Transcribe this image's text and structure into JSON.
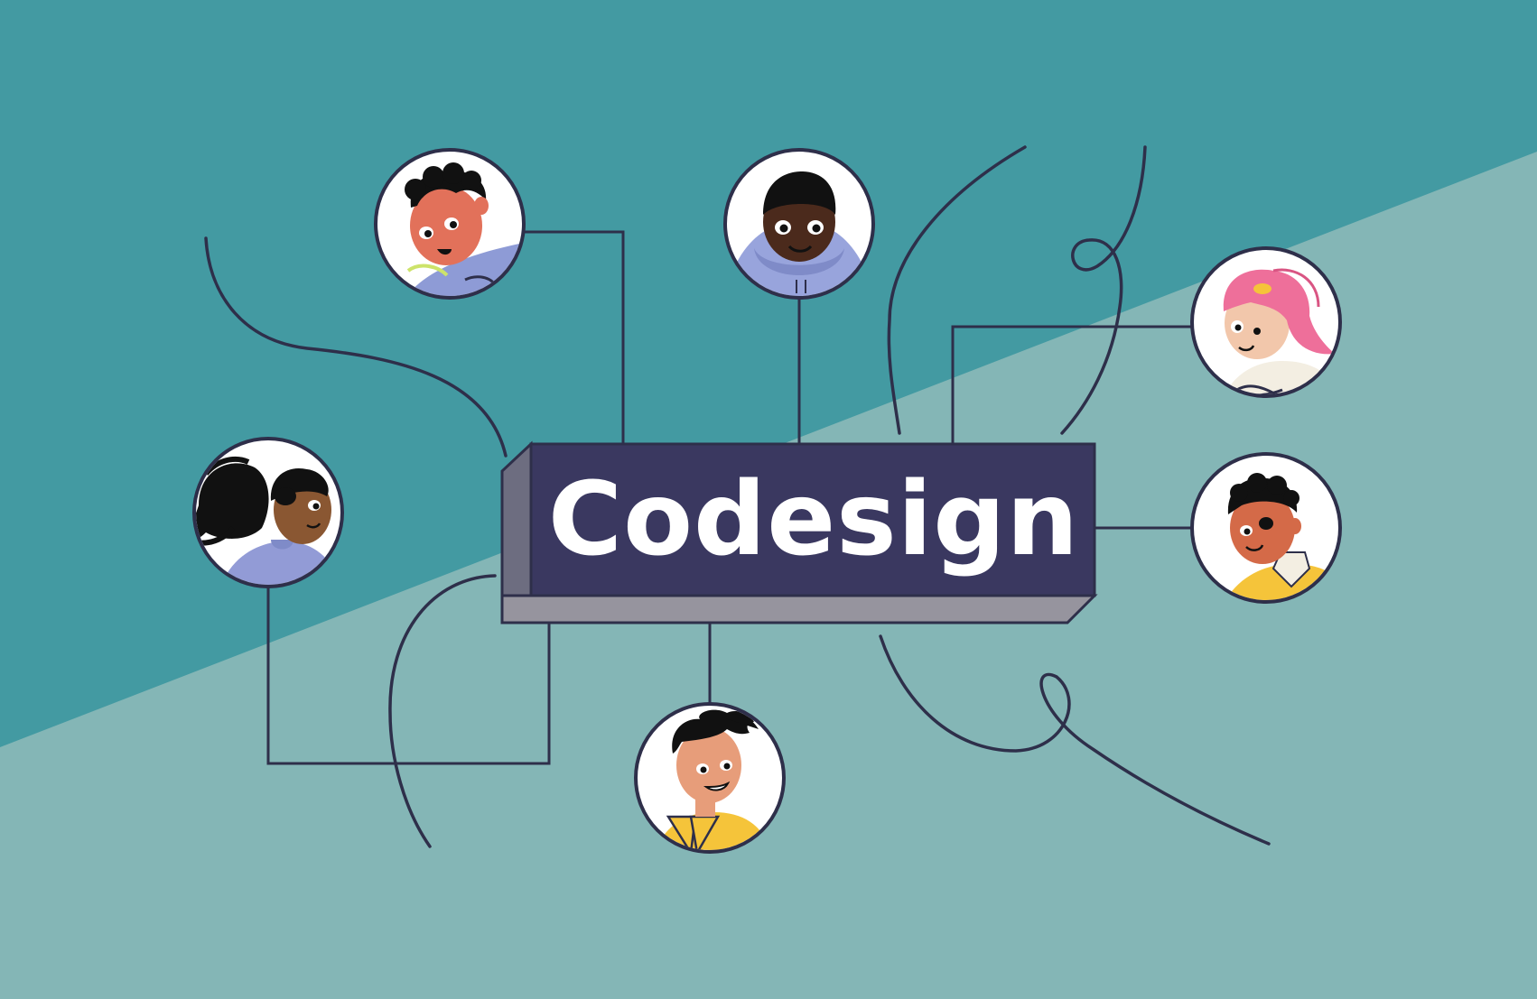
{
  "title": "Codesign",
  "colors": {
    "background_dark": "#439aa2",
    "background_light": "#84b6b6",
    "block_front": "#3a3860",
    "block_top": "#6d6d80",
    "block_bottom": "#96949e",
    "line": "#2e2f4a"
  },
  "avatars": [
    {
      "id": "curly-hair-person-avatar",
      "skin": "#e2715a",
      "hair": "#111111",
      "clothing": "#8e9bd6"
    },
    {
      "id": "hoodie-person-avatar",
      "skin": "#4b2a1c",
      "hair": "#111111",
      "clothing": "#98a4dc"
    },
    {
      "id": "pink-hair-person-avatar",
      "skin": "#f2c7ab",
      "hair": "#ee6f9a",
      "clothing": "#f3eee2"
    },
    {
      "id": "ponytail-person-avatar",
      "skin": "#8a5732",
      "hair": "#111111",
      "clothing": "#929bd6"
    },
    {
      "id": "collared-shirt-person-avatar",
      "skin": "#d46a48",
      "hair": "#111111",
      "clothing": "#f5c43a"
    },
    {
      "id": "spiky-hair-person-avatar",
      "skin": "#e79d7a",
      "hair": "#111111",
      "clothing": "#f5c43a"
    }
  ]
}
